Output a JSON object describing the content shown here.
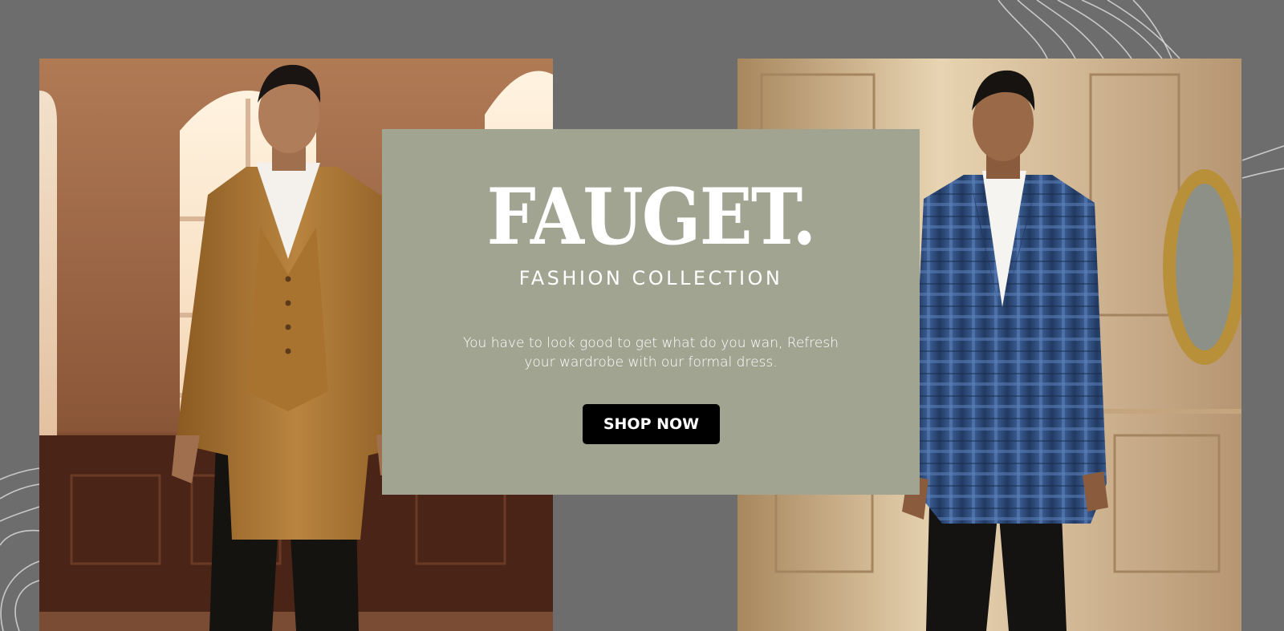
{
  "hero": {
    "brand": "FAUGET.",
    "subtitle": "FASHION COLLECTION",
    "tagline": "You have to look good to get what do you wan, Refresh your wardrobe with our formal dress.",
    "cta_label": "SHOP NOW"
  },
  "images": {
    "left": "man-in-tan-three-piece-suit-photo",
    "right": "man-in-blue-plaid-blazer-photo"
  },
  "colors": {
    "background": "#6d6d6d",
    "panel": "#a2a492",
    "button": "#000000",
    "text": "#ffffff"
  }
}
